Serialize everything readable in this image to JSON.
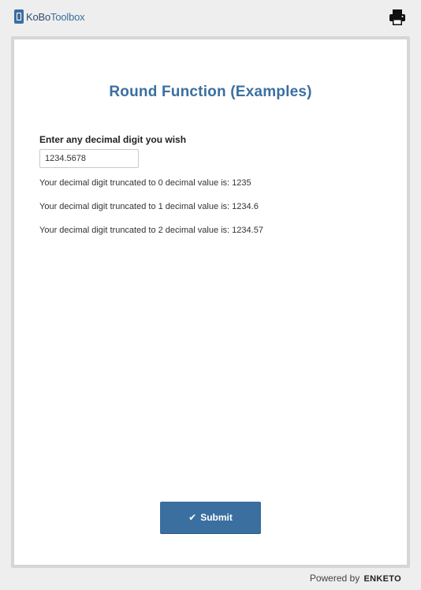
{
  "header": {
    "logo_kobo": "KoBo",
    "logo_toolbox": "Toolbox",
    "print_icon": "printer-icon"
  },
  "form": {
    "title": "Round Function (Examples)",
    "question_label": "Enter any decimal digit you wish",
    "input_value": "1234.5678",
    "notes": [
      "Your decimal digit truncated to 0 decimal value is: 1235",
      "Your decimal digit truncated to 1 decimal value is: 1234.6",
      "Your decimal digit truncated to 2 decimal value is: 1234.57"
    ],
    "submit_label": "Submit",
    "submit_icon": "check-icon"
  },
  "footer": {
    "powered_by": "Powered by",
    "brand": "ENKETO"
  },
  "colors": {
    "accent": "#3b6fa0",
    "background": "#eeeeee",
    "card_border": "#d6d6d6"
  }
}
